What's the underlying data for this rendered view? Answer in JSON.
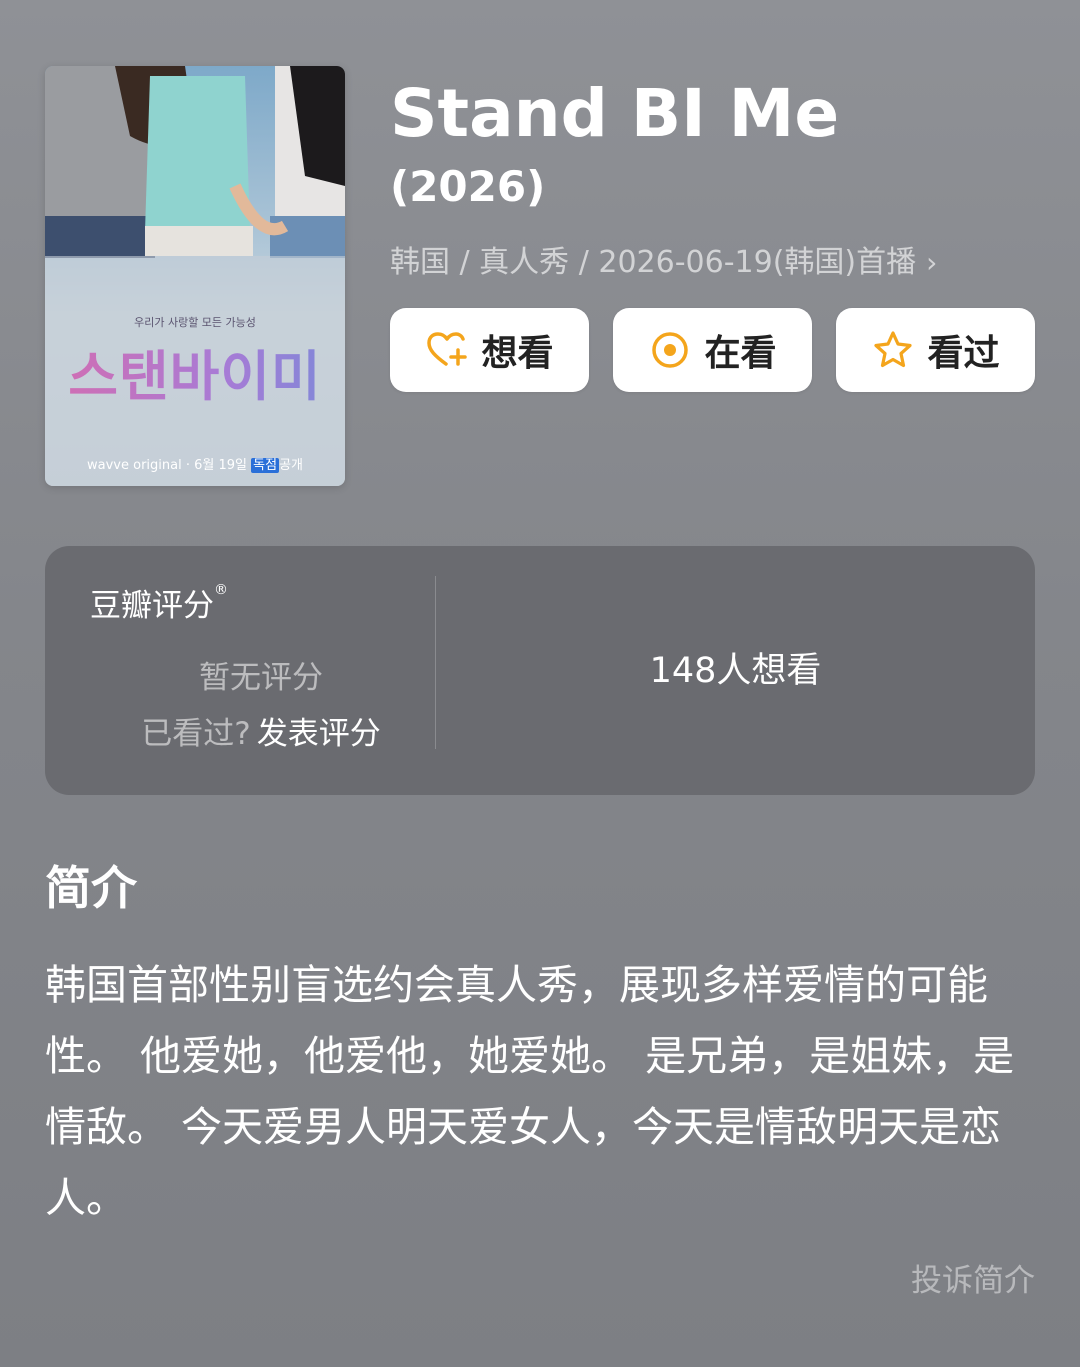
{
  "poster": {
    "tagline": "우리가 사랑할 모든 가능성",
    "logo_text": "스탠바이미",
    "footer_brand": "wavve original",
    "footer_date": "· 6월 19일",
    "footer_badge": "독점",
    "footer_end": "공개"
  },
  "title": "Stand BI Me",
  "year": "(2026)",
  "meta": "韩国 / 真人秀 / 2026-06-19(韩国)首播",
  "actions": {
    "want": "想看",
    "watching": "在看",
    "watched": "看过"
  },
  "rating": {
    "label": "豆瓣评分",
    "mark": "®",
    "no_rating": "暂无评分",
    "seen_question": "已看过?",
    "rate_link": "发表评分",
    "want_count": "148人想看"
  },
  "intro": {
    "heading": "简介",
    "text": "韩国首部性别盲选约会真人秀，展现多样爱情的可能性。 他爱她，他爱他，她爱她。 是兄弟，是姐妹，是情敌。 今天爱男人明天爱女人，今天是情敌明天是恋人。",
    "report": "投诉简介"
  },
  "colors": {
    "icon_accent": "#f4a51c",
    "background": "#87898e",
    "card": "#6a6b70"
  }
}
